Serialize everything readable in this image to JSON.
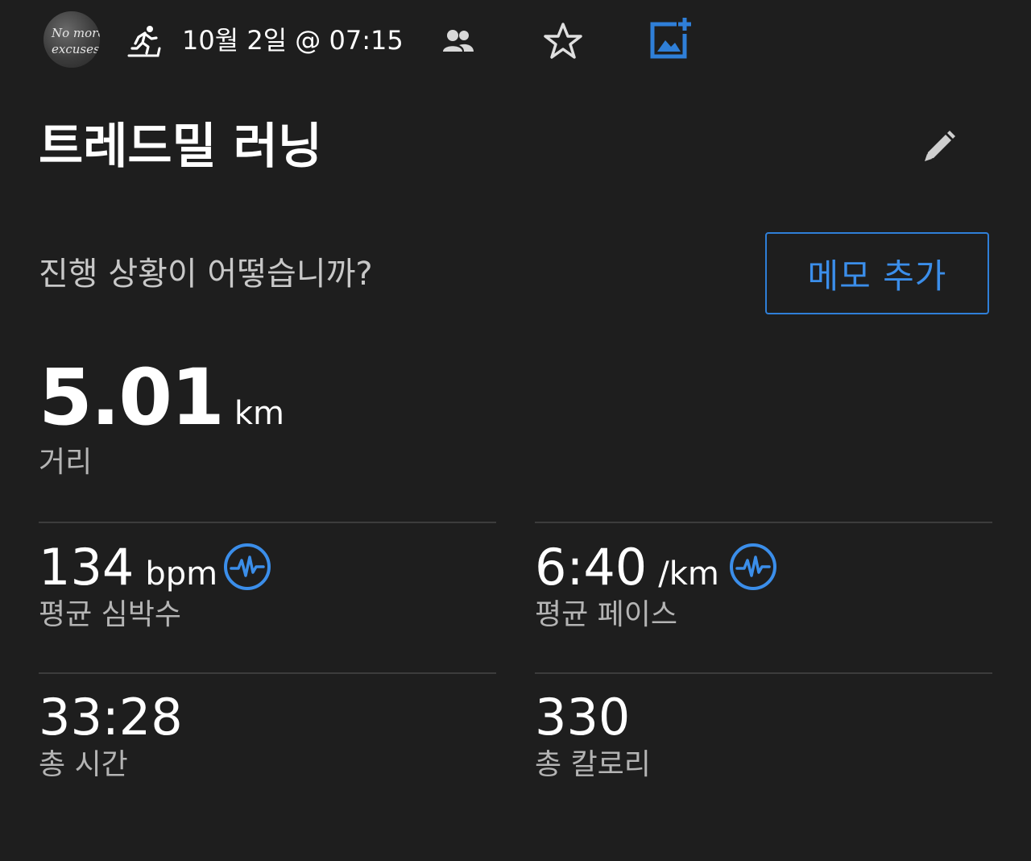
{
  "header": {
    "avatar_text": "No more excuses",
    "activity_icon": "treadmill-running-icon",
    "date_time": "10월 2일 @ 07:15",
    "people_icon": "people-icon",
    "star_icon": "star-outline-icon",
    "photo_icon": "add-photo-icon",
    "accent_color": "#2f7fd8"
  },
  "activity": {
    "title": "트레드밀 러닝",
    "edit_icon": "pencil-icon"
  },
  "progress": {
    "prompt": "진행 상황이 어떻습니까?",
    "memo_button_label": "메모 추가"
  },
  "distance": {
    "value": "5.01",
    "unit": "km",
    "label": "거리"
  },
  "stats": {
    "avg_heart_rate": {
      "value": "134",
      "unit": "bpm",
      "label": "평균 심박수",
      "icon": "pulse-icon"
    },
    "avg_pace": {
      "value": "6:40",
      "unit": "/km",
      "label": "평균 페이스",
      "icon": "pulse-icon"
    },
    "total_time": {
      "value": "33:28",
      "label": "총 시간"
    },
    "total_calories": {
      "value": "330",
      "label": "총 칼로리"
    }
  }
}
